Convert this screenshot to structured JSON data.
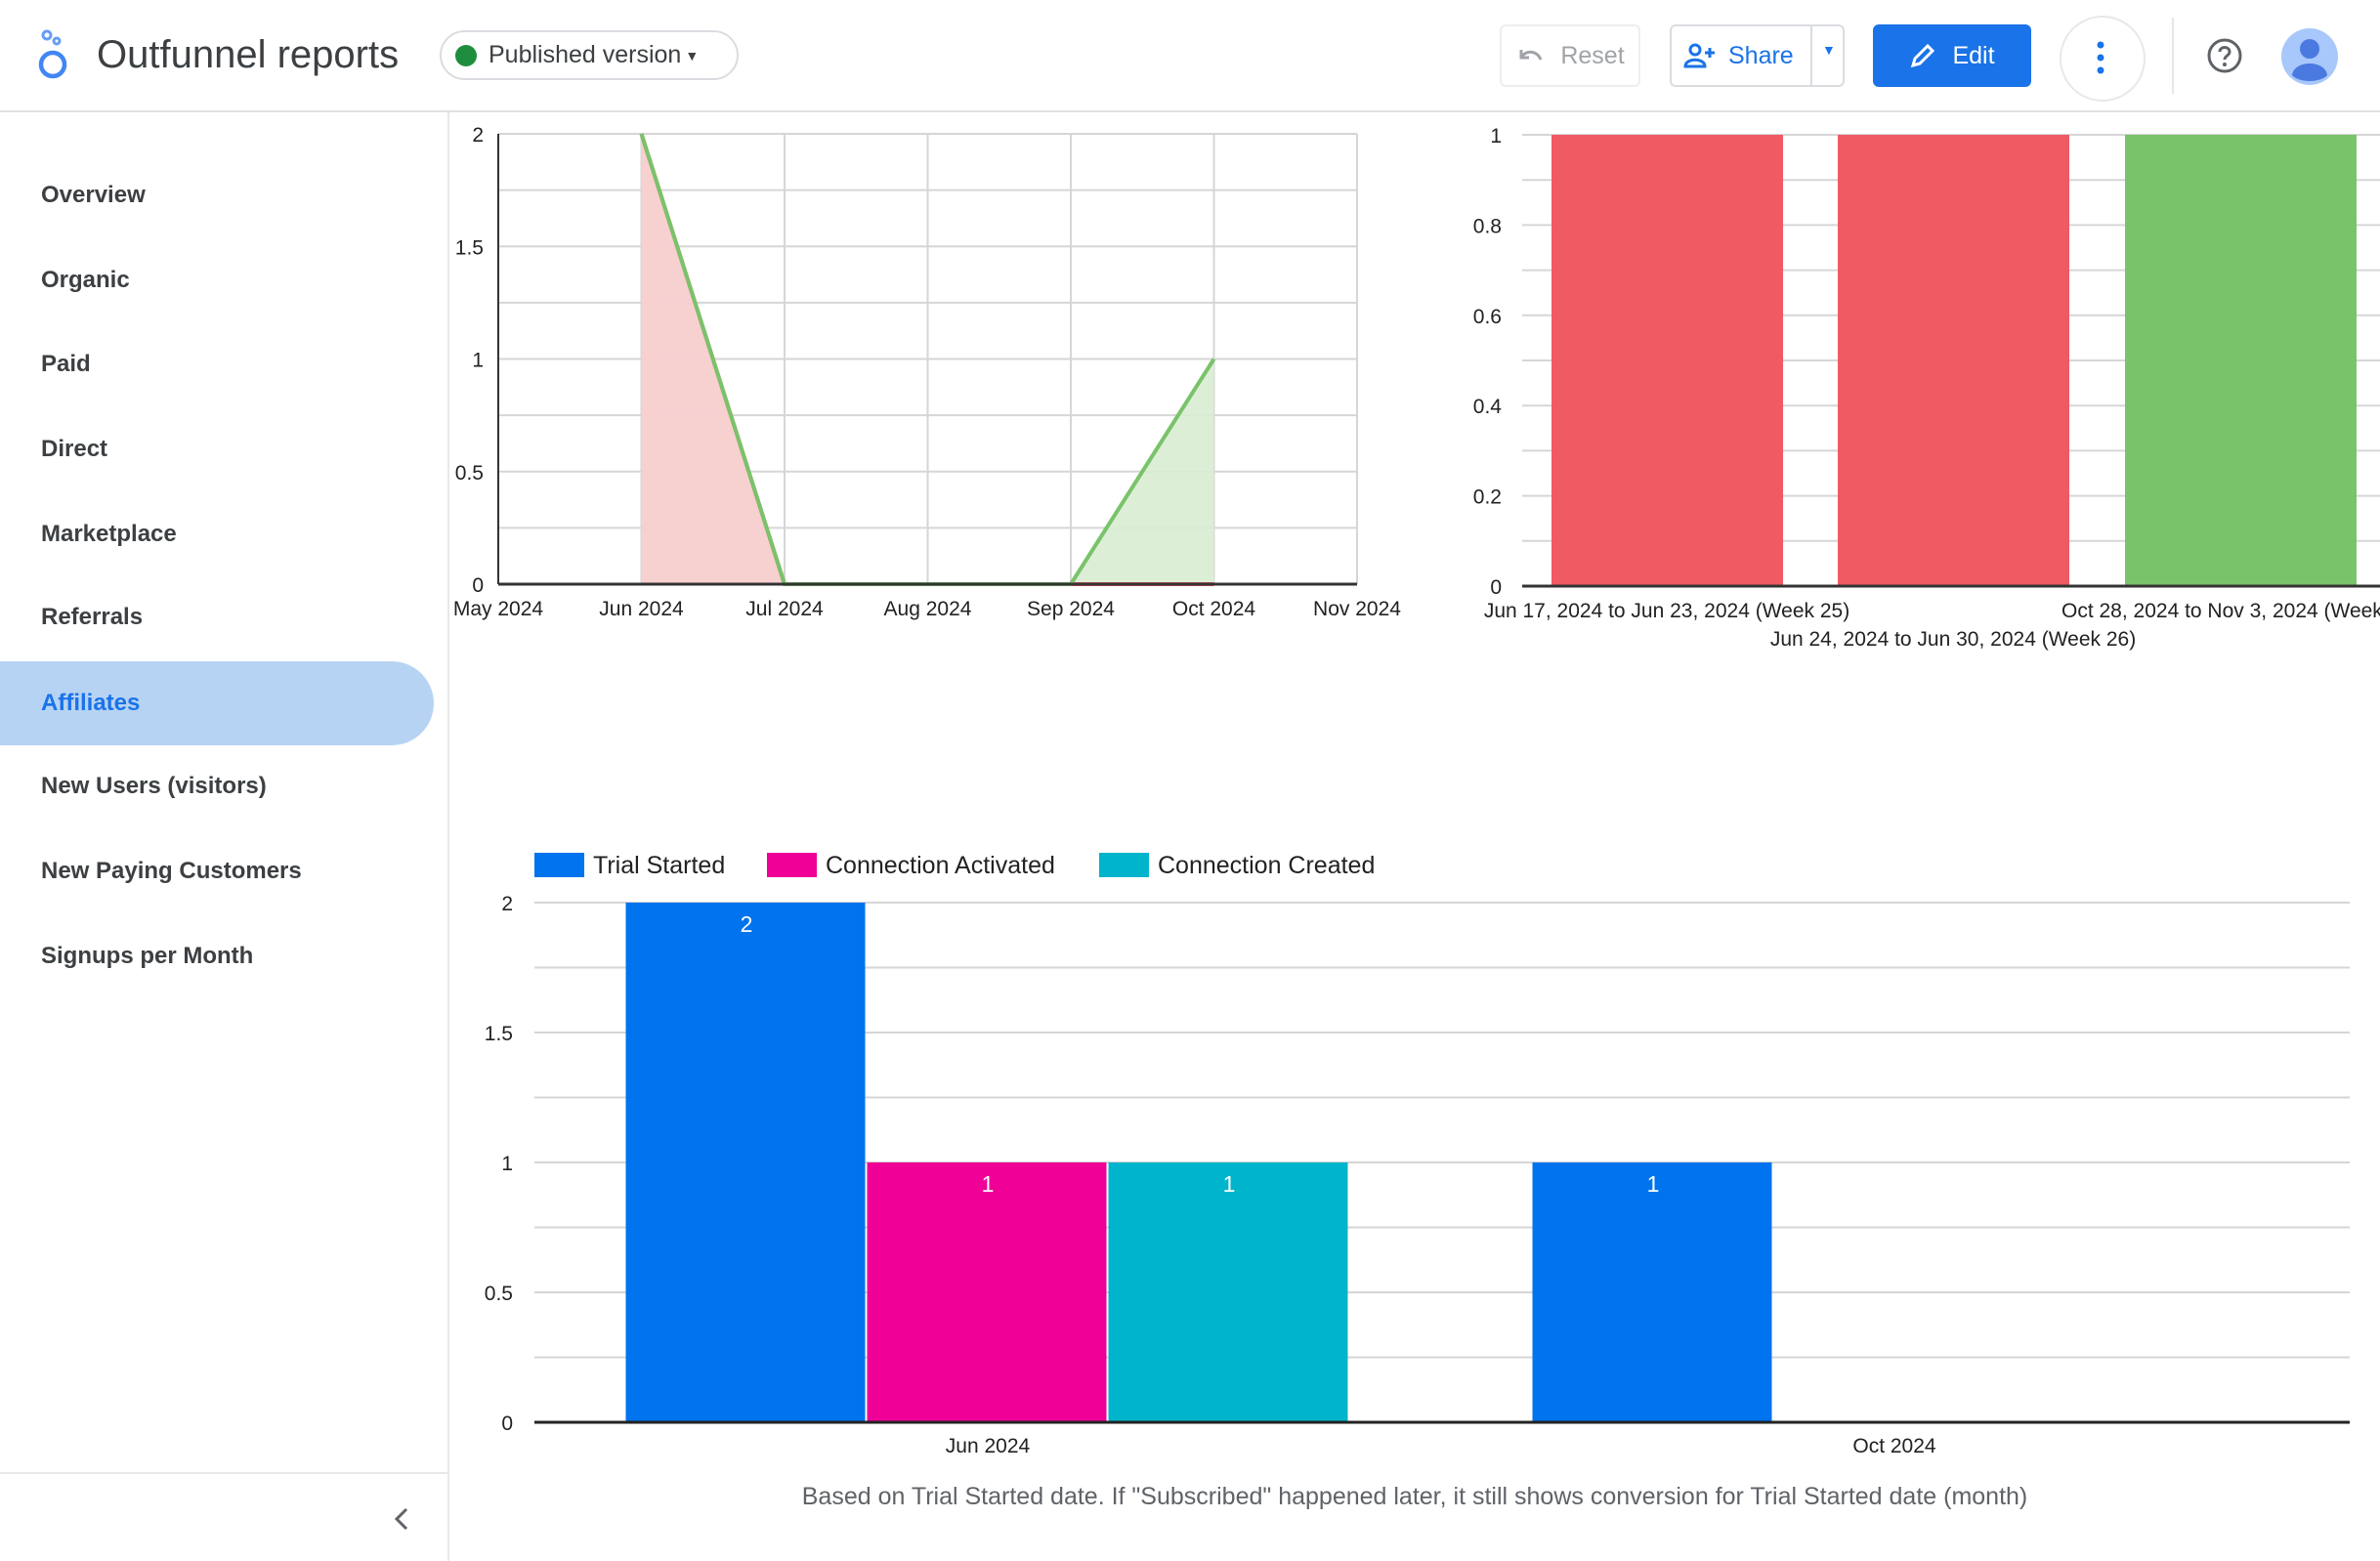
{
  "header": {
    "app_title": "Outfunnel reports",
    "version_label": "Published version",
    "reset_label": "Reset",
    "share_label": "Share",
    "edit_label": "Edit",
    "icons": [
      "looker-studio-logo-icon",
      "undo-icon",
      "person-add-icon",
      "chevron-down-icon",
      "pencil-icon",
      "more-vert-icon",
      "help-icon",
      "avatar-icon"
    ],
    "colors": {
      "primary": "#1a73e8",
      "published_dot": "#1e8e3e"
    }
  },
  "sidebar": {
    "items": [
      {
        "label": "Overview"
      },
      {
        "label": "Organic"
      },
      {
        "label": "Paid"
      },
      {
        "label": "Direct"
      },
      {
        "label": "Marketplace"
      },
      {
        "label": "Referrals"
      },
      {
        "label": "Affiliates",
        "active": true
      },
      {
        "label": "New Users (visitors)"
      },
      {
        "label": "New Paying Customers"
      },
      {
        "label": "Signups per Month"
      }
    ]
  },
  "chart_data": [
    {
      "type": "area",
      "categories": [
        "May 2024",
        "Jun 2024",
        "Jul 2024",
        "Aug 2024",
        "Sep 2024",
        "Oct 2024",
        "Nov 2024"
      ],
      "series": [
        {
          "color": "#f05a63",
          "fill": "#f9cccf",
          "values": [
            null,
            2,
            0,
            0,
            0,
            0,
            null
          ]
        },
        {
          "color": "#79c36a",
          "fill": "#d9ecd3",
          "values": [
            null,
            2,
            0,
            0,
            0,
            1,
            null
          ]
        }
      ],
      "yticks": [
        "0",
        "0.5",
        "1",
        "1.5",
        "2"
      ],
      "ylim": [
        0,
        2
      ],
      "grid": true
    },
    {
      "type": "bar",
      "categories": [
        "Jun 17, 2024 to Jun 23, 2024 (Week 25)",
        "Jun 24, 2024 to Jun 30, 2024 (Week 26)",
        "Oct 28, 2024 to Nov 3, 2024 (Week"
      ],
      "values": [
        1,
        1,
        1
      ],
      "colors": [
        "#f05a63",
        "#f05a63",
        "#79c36a"
      ],
      "yticks": [
        "0",
        "0.2",
        "0.4",
        "0.6",
        "0.8",
        "1"
      ],
      "ylim": [
        0,
        1
      ],
      "grid": true
    },
    {
      "type": "bar",
      "categories": [
        "Jun 2024",
        "Oct 2024"
      ],
      "series": [
        {
          "name": "Trial Started",
          "color": "#0073ee",
          "values": [
            2,
            1
          ]
        },
        {
          "name": "Connection Activated",
          "color": "#ef0097",
          "values": [
            1,
            0
          ]
        },
        {
          "name": "Connection Created",
          "color": "#00b5cb",
          "values": [
            1,
            0
          ]
        }
      ],
      "yticks": [
        "0",
        "0.5",
        "1",
        "1.5",
        "2"
      ],
      "ylim": [
        0,
        2
      ],
      "legend": "top-left",
      "data_labels": true,
      "grid": true,
      "footnote": "Based on Trial Started date. If \"Subscribed\" happened later, it still shows conversion for Trial Started date (month)"
    }
  ]
}
